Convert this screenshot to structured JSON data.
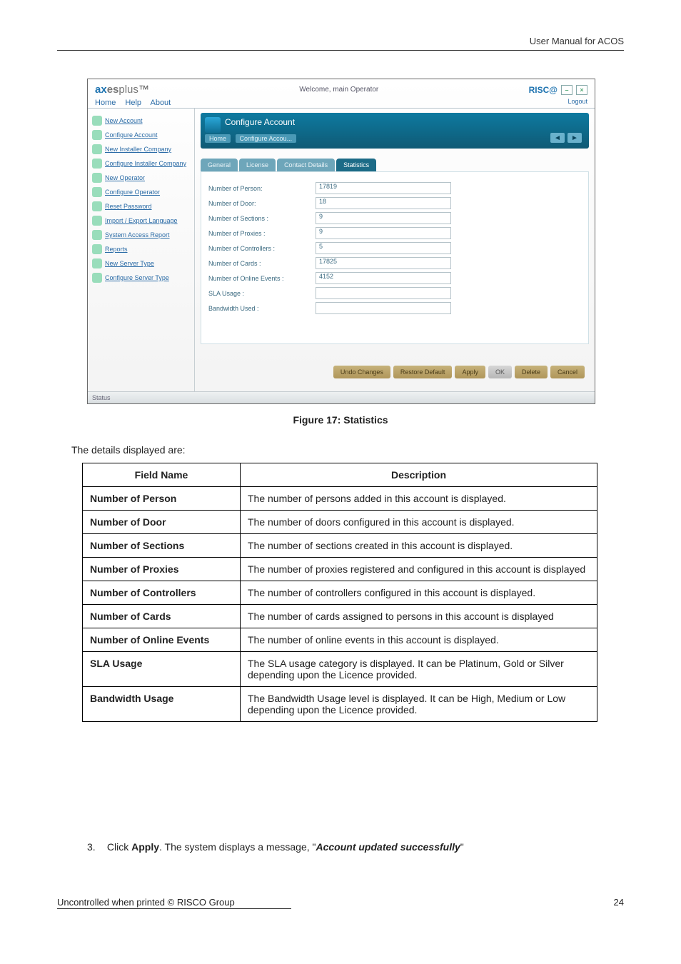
{
  "header": {
    "doc_title": "User Manual for ACOS"
  },
  "footer": {
    "text": "Uncontrolled when printed © RISCO Group",
    "page": "24"
  },
  "caption": "Figure 17: Statistics",
  "intro": "The details displayed are:",
  "step": {
    "num": "3.",
    "pre": "Click ",
    "bold1": "Apply",
    "mid": ". The system displays a message, \"",
    "boldItal": "Account updated successfully",
    "end": "\""
  },
  "table": {
    "head": {
      "field": "Field Name",
      "desc": "Description"
    },
    "rows": [
      {
        "field": "Number of Person",
        "desc": "The number of persons added in this account is displayed."
      },
      {
        "field": "Number of Door",
        "desc": "The number of doors configured in this account is displayed."
      },
      {
        "field": "Number of Sections",
        "desc": "The number of sections created in this account is displayed."
      },
      {
        "field": "Number of Proxies",
        "desc": "The number of proxies registered and configured in this account is displayed"
      },
      {
        "field": "Number of Controllers",
        "desc": "The number of controllers configured in this account is displayed."
      },
      {
        "field": "Number of Cards",
        "desc": "The number of cards assigned to persons in this account is displayed"
      },
      {
        "field": "Number of Online Events",
        "desc": "The number of online events in this account is displayed."
      },
      {
        "field": "SLA Usage",
        "desc": "The SLA usage category is displayed. It can be Platinum, Gold or Silver depending upon the Licence provided."
      },
      {
        "field": "Bandwidth Usage",
        "desc": "The Bandwidth Usage level is displayed. It can be High, Medium or Low depending upon the Licence provided."
      }
    ]
  },
  "shot": {
    "brand": {
      "ax": "ax",
      "es": "es",
      "plus": "plus",
      "tm": "™"
    },
    "welcome": "Welcome, main Operator",
    "risco": "RISC@",
    "menu": {
      "home": "Home",
      "help": "Help",
      "about": "About"
    },
    "logout": "Logout",
    "side": [
      "New Account",
      "Configure Account",
      "New Installer Company",
      "Configure Installer Company",
      "New Operator",
      "Configure Operator",
      "Reset Password",
      "Import / Export Language",
      "System Access Report",
      "Reports",
      "New Server Type",
      "Configure Server Type"
    ],
    "panel": {
      "title": "Configure Account",
      "crumb_home": "Home",
      "crumb_cur": "Configure Accou...",
      "prev": "◄",
      "next": "►"
    },
    "tabs": {
      "general": "General",
      "license": "License",
      "contact": "Contact Details",
      "stats": "Statistics"
    },
    "fields": [
      {
        "label": "Number of Person:",
        "value": "17819"
      },
      {
        "label": "Number of Door:",
        "value": "18"
      },
      {
        "label": "Number of Sections :",
        "value": "9"
      },
      {
        "label": "Number of Proxies :",
        "value": "9"
      },
      {
        "label": "Number of Controllers :",
        "value": "5"
      },
      {
        "label": "Number of Cards :",
        "value": "17825"
      },
      {
        "label": "Number of Online Events :",
        "value": "4152"
      },
      {
        "label": "SLA Usage :",
        "value": ""
      },
      {
        "label": "Bandwidth Used :",
        "value": ""
      }
    ],
    "buttons": {
      "undo": "Undo Changes",
      "restore": "Restore Default",
      "apply": "Apply",
      "ok": "OK",
      "delete": "Delete",
      "cancel": "Cancel"
    },
    "status": "Status"
  }
}
